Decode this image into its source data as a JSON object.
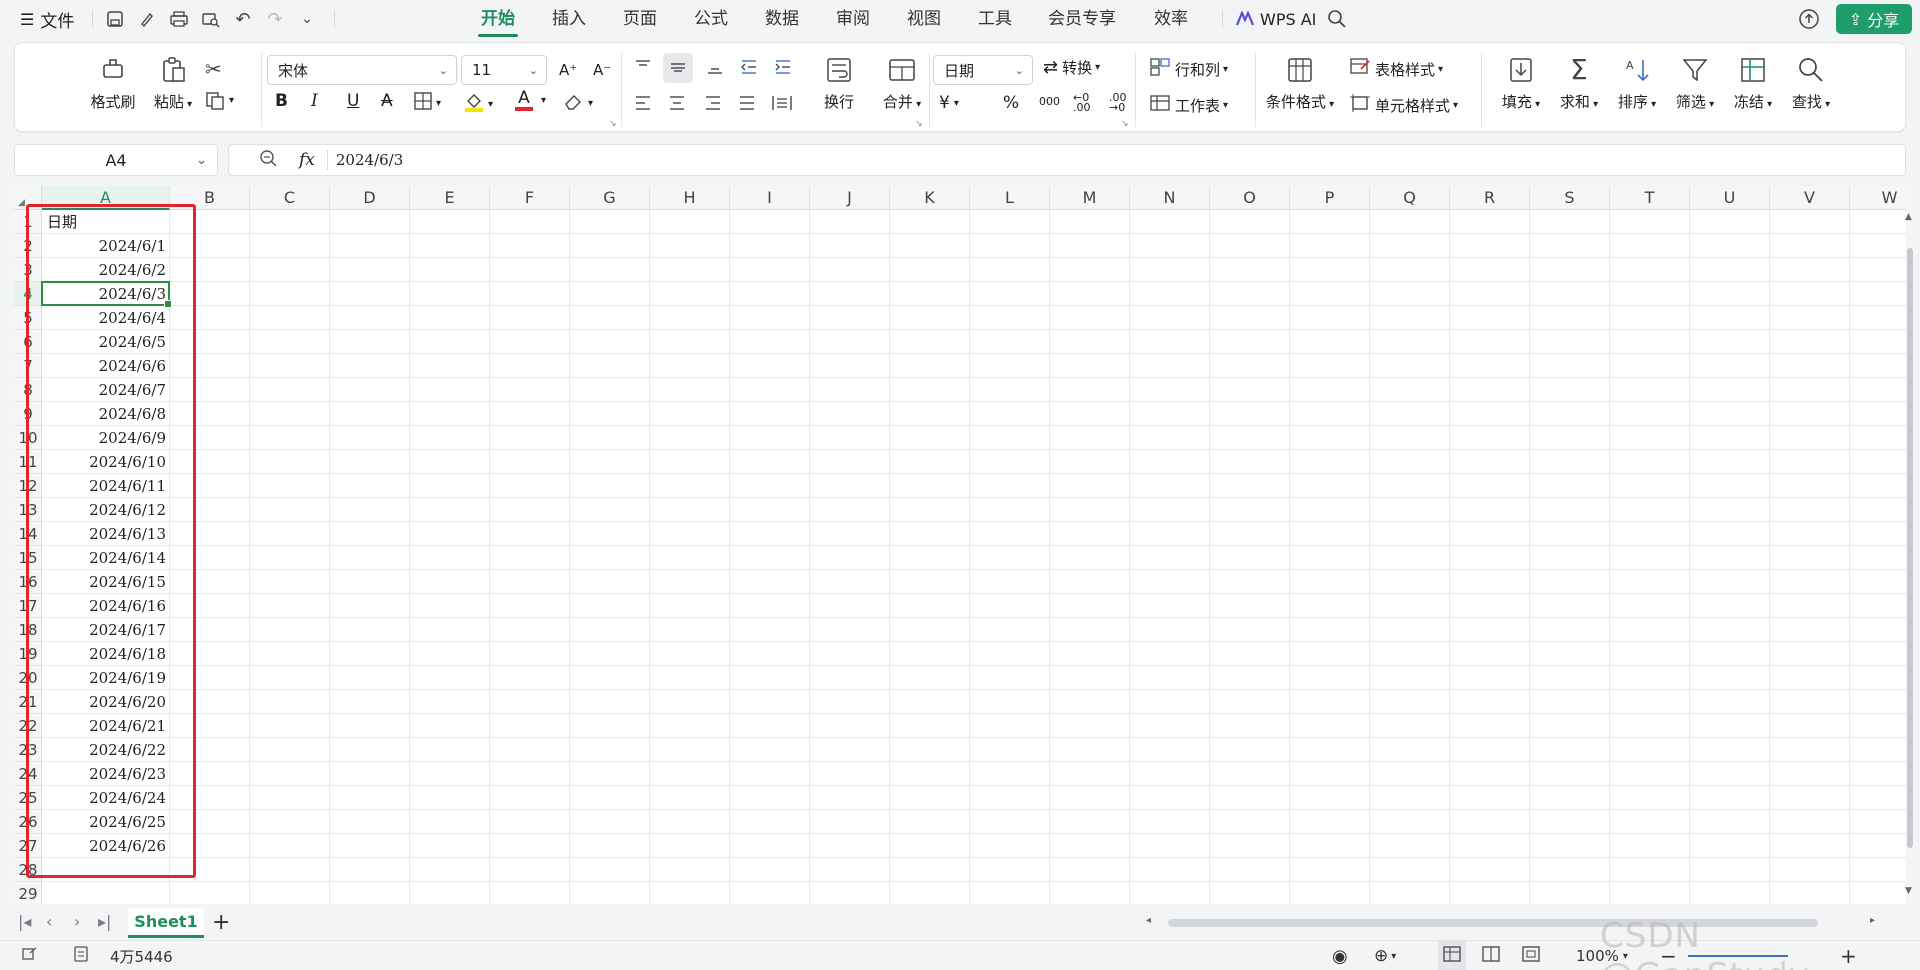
{
  "titlebar": {
    "file_menu": "文件",
    "tabs": [
      "开始",
      "插入",
      "页面",
      "公式",
      "数据",
      "审阅",
      "视图",
      "工具",
      "会员专享",
      "效率"
    ],
    "active_tab": "开始",
    "wps_ai": "WPS AI",
    "share": "分享"
  },
  "ribbon": {
    "format_painter": "格式刷",
    "paste": "粘贴",
    "font_name": "宋体",
    "font_size": "11",
    "wrap": "换行",
    "merge": "合并",
    "number_format": "日期",
    "convert": "转换",
    "rows_cols": "行和列",
    "worksheet": "工作表",
    "cond_format": "条件格式",
    "table_style": "表格样式",
    "cell_style": "单元格样式",
    "fill": "填充",
    "sum": "求和",
    "sort": "排序",
    "filter": "筛选",
    "freeze": "冻结",
    "find": "查找",
    "currency_symbol": "¥",
    "percent_symbol": "%",
    "thousands_symbol": "000",
    "bold": "B",
    "italic": "I",
    "underline": "U",
    "strike": "A",
    "font_color_letter": "A",
    "grow_font": "A⁺",
    "shrink_font": "A⁻"
  },
  "formula_bar": {
    "name_box": "A4",
    "fx": "fx",
    "value": "2024/6/3"
  },
  "sheet": {
    "columns": [
      "A",
      "B",
      "C",
      "D",
      "E",
      "F",
      "G",
      "H",
      "I",
      "J",
      "K",
      "L",
      "M",
      "N",
      "O",
      "P",
      "Q",
      "R",
      "S",
      "T",
      "U",
      "V",
      "W"
    ],
    "rows": [
      "1",
      "2",
      "3",
      "4",
      "5",
      "6",
      "7",
      "8",
      "9",
      "10",
      "11",
      "12",
      "13",
      "14",
      "15",
      "16",
      "17",
      "18",
      "19",
      "20",
      "21",
      "22",
      "23",
      "24",
      "25",
      "26",
      "27",
      "28",
      "29"
    ],
    "header_cell": "日期",
    "col_a_values": [
      "2024/6/1",
      "2024/6/2",
      "2024/6/3",
      "2024/6/4",
      "2024/6/5",
      "2024/6/6",
      "2024/6/7",
      "2024/6/8",
      "2024/6/9",
      "2024/6/10",
      "2024/6/11",
      "2024/6/12",
      "2024/6/13",
      "2024/6/14",
      "2024/6/15",
      "2024/6/16",
      "2024/6/17",
      "2024/6/18",
      "2024/6/19",
      "2024/6/20",
      "2024/6/21",
      "2024/6/22",
      "2024/6/23",
      "2024/6/24",
      "2024/6/25",
      "2024/6/26"
    ],
    "active_cell": "A4"
  },
  "tabs_bar": {
    "sheet_name": "Sheet1",
    "add": "+"
  },
  "statusbar": {
    "word_count": "4万5446",
    "zoom": "100%"
  },
  "watermark": "CSDN @GanStudy",
  "colors": {
    "accent": "#1e8e5c",
    "highlight_box": "#e0262b",
    "active_cell_border": "#2f8f3e"
  }
}
